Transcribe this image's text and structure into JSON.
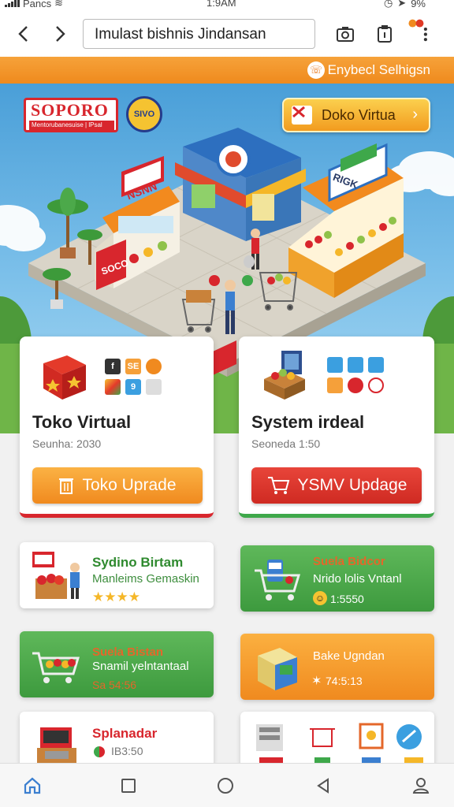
{
  "status_bar": {
    "carrier": "Pancs",
    "time": "1:9AM",
    "battery": "9%"
  },
  "browser": {
    "url_text": "Imulast bishnis Jindansan"
  },
  "banner": {
    "label": "Enybecl Selhigsn"
  },
  "hero": {
    "logo_title": "SOPORO",
    "logo_subtitle": "Mentorubanesuise | lPsal",
    "seal_text": "SIVO",
    "button_label": "Doko Virtua",
    "stall_sign_left": "NSNN",
    "stall_sign_right": "RIGK",
    "stall_sign_front": "SOCO"
  },
  "cards": [
    {
      "title": "Toko Virtual",
      "subtitle": "Seunha: 2030",
      "button": "Toko Uprade",
      "accent": "#f39a1e"
    },
    {
      "title": "System irdeal",
      "subtitle": "Seoneda 1:50",
      "button": "YSMV Updage",
      "accent": "#dc2f28"
    }
  ],
  "small_cards": [
    {
      "line1": "Sydino Birtam",
      "line2": "Manleims Gemaskin",
      "line3": "",
      "theme": "white",
      "rating": 4
    },
    {
      "line1": "Suela Bidcor",
      "line2": "Nrido lolis Vntanl",
      "line3": "1:5550",
      "theme": "green"
    },
    {
      "line1": "Suela Bistan",
      "line2": "Snamil yelntantaal",
      "line3": "Sa 54:56",
      "theme": "green"
    },
    {
      "line1": "",
      "line2": "Bake Ugndan",
      "line3": "74:5:13",
      "theme": "orange"
    },
    {
      "line1": "Splanadar",
      "line2": "IB3:50",
      "line3": "",
      "theme": "white"
    },
    {
      "line1": "",
      "line2": "",
      "line3": "",
      "theme": "white"
    }
  ],
  "card_mini_icons_left": [
    "f",
    "SE",
    "",
    "",
    "9",
    ""
  ],
  "card_mini_icons_right": [
    "",
    "",
    "",
    "",
    "",
    ""
  ],
  "bottom_nav": [
    "home-icon",
    "square-icon",
    "circle-icon",
    "back-triangle-icon",
    "person-icon"
  ]
}
